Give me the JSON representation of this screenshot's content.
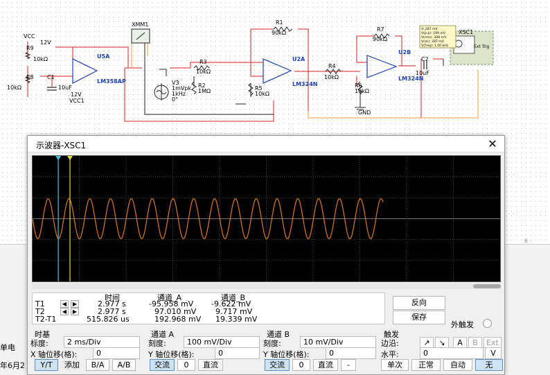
{
  "schematic": {
    "vcc_label": "VCC",
    "v12": "12V",
    "r9": "R9",
    "r9_val": "10kΩ",
    "r8": "R8",
    "r8_val": "10kΩ",
    "c1": "C1",
    "c1_val": "10uF",
    "u5a": "U5A",
    "u5a_part": "LM358AP",
    "neg12": "12V",
    "vcc1": "VCC1",
    "xmm1": "XMM1",
    "r3": "R3",
    "r3_val": "10kΩ",
    "v3": "V3",
    "v3_amp": "1mVpk",
    "v3_freq": "1kHz",
    "v3_phase": "0°",
    "r2": "R2",
    "r2_val": "1MΩ",
    "r1": "R1",
    "r1_val": "90kΩ",
    "u2a": "U2A",
    "u2a_part": "LM324N",
    "r5": "R5",
    "r5_val": "10kΩ",
    "r4": "R4",
    "r4_val": "10kΩ",
    "r7": "R7",
    "r7_val": "90kΩ",
    "u2b": "U2B",
    "u2b_part": "LM324N",
    "r6": "R6",
    "r6_val": "10kΩ",
    "gnd": "GND",
    "c2": "C2",
    "c2_val": "10uF",
    "xsc1": "XSC1",
    "ext_trig": "Ext Trig",
    "probe_lines": [
      "V: 287 mV",
      "V(p-p): 199 mV",
      "V(rms): 308 mV",
      "V(dc): 287 mV",
      "V(freq): 1.00 kHz"
    ],
    "page_num": "6"
  },
  "side_clips": {
    "left_top": "单电",
    "left_bottom": "年6月2"
  },
  "scope": {
    "title": "示波器-XSC1",
    "readout": {
      "headers": [
        "时间",
        "通道_A",
        "通道_B"
      ],
      "rows": [
        {
          "label": "T1",
          "time": "2.977 s",
          "a": "-95.958 mV",
          "b": "-9.622 mV"
        },
        {
          "label": "T2",
          "time": "2.977 s",
          "a": "97.010 mV",
          "b": "9.717 mV"
        },
        {
          "label": "T2-T1",
          "time": "515.826 us",
          "a": "192.968 mV",
          "b": "19.339 mV"
        }
      ]
    },
    "reverse_button": "反向",
    "save_button": "保存",
    "ext_trigger_label": "外触发",
    "timebase": {
      "title": "时基",
      "scale_label": "标度:",
      "scale_value": "2 ms/Div",
      "xpos_label": "X 轴位移(格):",
      "xpos_value": "0",
      "btn_yt": "Y/T",
      "btn_add": "添加",
      "btn_ba": "B/A",
      "btn_ab": "A/B"
    },
    "channel_a": {
      "title": "通道 A",
      "scale_label": "刻度:",
      "scale_value": "100 mV/Div",
      "ypos_label": "Y 轴位移(格):",
      "ypos_value": "0",
      "btn_ac": "交流",
      "btn_zero": "0",
      "btn_dc": "直流"
    },
    "channel_b": {
      "title": "通道 B",
      "scale_label": "刻度:",
      "scale_value": "10 mV/Div",
      "ypos_label": "Y 轴位移(格):",
      "ypos_value": "0",
      "btn_ac": "交流",
      "btn_zero": "0",
      "btn_dc": "直流",
      "btn_minus": "-"
    },
    "trigger": {
      "title": "触发",
      "edge_label": "边沿:",
      "edge_rise": "↗",
      "edge_fall": "↘",
      "src_a": "A",
      "src_b": "B",
      "src_ext": "Ext",
      "level_label": "水平:",
      "level_value": "0",
      "level_unit": "V",
      "btn_single": "单次",
      "btn_normal": "正常",
      "btn_auto": "自动",
      "btn_none": "无"
    },
    "waveform": {
      "channel_a_color": "#e07a10",
      "cursor1_color": "#3fc4e0",
      "cursor2_color": "#e8e030",
      "amplitude_div": 0.96,
      "cycles_visible": 10,
      "trace_end_div": 7.5
    }
  }
}
